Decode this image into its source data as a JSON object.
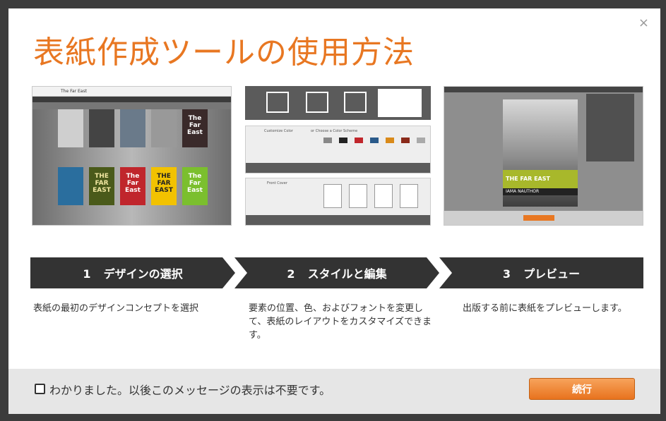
{
  "dialog": {
    "title": "表紙作成ツールの使用方法",
    "close_glyph": "×",
    "accent_color": "#e87722"
  },
  "screenshots": [
    {
      "name": "design-gallery",
      "window_title": "The Far East",
      "covers": [
        "The Far East",
        "THE FAR EAST",
        "The Far East",
        "THE FAR EAST",
        "The Far East"
      ]
    },
    {
      "name": "style-editor",
      "labels": [
        "Customize Color",
        "or Choose a Color Scheme",
        "Front Cover"
      ]
    },
    {
      "name": "preview",
      "cover_title": "THE FAR EAST",
      "cover_author": "IAMA NAUTHOR"
    }
  ],
  "steps": [
    {
      "num": "1",
      "label": "デザインの選択",
      "desc": "表紙の最初のデザインコンセプトを選択"
    },
    {
      "num": "2",
      "label": "スタイルと編集",
      "desc": "要素の位置、色、およびフォントを変更して、表紙のレイアウトをカスタマイズできます。"
    },
    {
      "num": "3",
      "label": "プレビュー",
      "desc": "出版する前に表紙をプレビューします。"
    }
  ],
  "footer": {
    "checkbox_label": "わかりました。以後このメッセージの表示は不要です。",
    "checkbox_checked": false,
    "continue_label": "続行"
  }
}
